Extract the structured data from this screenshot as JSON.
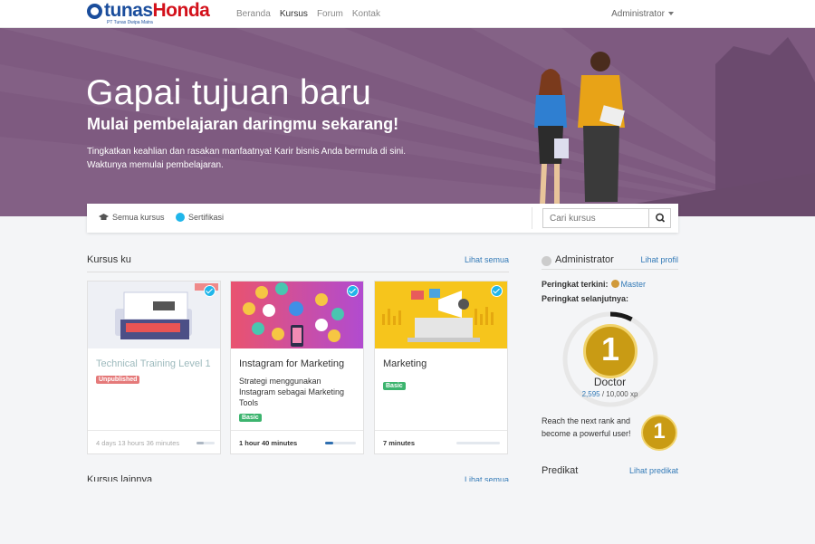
{
  "brand": {
    "name_part1": "tunas",
    "name_part2": "Honda",
    "tagline": "PT Tunas Dwipa Matra"
  },
  "nav": {
    "links": [
      "Beranda",
      "Kursus",
      "Forum",
      "Kontak"
    ],
    "active_index": 1,
    "user": "Administrator"
  },
  "hero": {
    "title": "Gapai tujuan baru",
    "subtitle": "Mulai pembelajaran daringmu sekarang!",
    "description": "Tingkatkan keahlian dan rasakan manfaatnya! Karir bisnis Anda bermula di sini. Waktunya memulai pembelajaran."
  },
  "filters": {
    "all_courses": "Semua kursus",
    "certification": "Sertifikasi",
    "search_placeholder": "Cari kursus"
  },
  "my_courses": {
    "title": "Kursus ku",
    "see_all": "Lihat semua",
    "cards": [
      {
        "title": "Technical Training Level 1",
        "desc": "",
        "badge": "Unpublished",
        "time": "4 days 13 hours 36 minutes",
        "progress": 0.4
      },
      {
        "title": "Instagram for Marketing",
        "desc": "Strategi menggunakan Instagram sebagai Marketing Tools",
        "badge": "Basic",
        "time": "1 hour 40 minutes",
        "progress": 0.25
      },
      {
        "title": "Marketing",
        "desc": "",
        "badge": "Basic",
        "time": "7 minutes",
        "progress": 0.0
      }
    ]
  },
  "next_section": {
    "title": "Kursus lainnya",
    "see_all": "Lihat semua"
  },
  "sidebar": {
    "name": "Administrator",
    "profile_link": "Lihat profil",
    "current_rank_label": "Peringkat terkini:",
    "current_rank": "Master",
    "next_rank_label": "Peringkat selanjutnya:",
    "medal_number": "1",
    "next_rank": "Doctor",
    "xp_current": "2,595",
    "xp_total": "10,000 xp",
    "xp_progress": 0.26,
    "reach_text": "Reach the next rank and become a powerful user!",
    "predicate_title": "Predikat",
    "predicate_link": "Lihat predikat"
  },
  "colors": {
    "hero": "#7e5a80",
    "accent": "#20b6ea",
    "link": "#337ab7",
    "medal": "#c99b14"
  }
}
